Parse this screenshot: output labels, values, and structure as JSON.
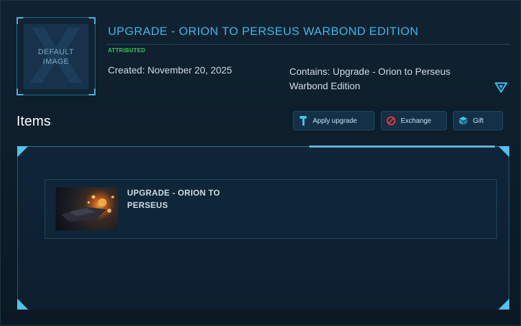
{
  "pledge": {
    "thumbnail_text_line1": "DEFAULT",
    "thumbnail_text_line2": "IMAGE",
    "title": "UPGRADE - ORION TO PERSEUS WARBOND EDITION",
    "badge": "ATTRIBUTED",
    "created": "Created: November 20, 2025",
    "contains": "Contains: Upgrade - Orion to Perseus Warbond Edition",
    "toggle_icon": "chevron-down-triangle-icon"
  },
  "items_section": {
    "heading": "Items",
    "buttons": [
      {
        "label": "Apply upgrade",
        "icon": "hammer-icon"
      },
      {
        "label": "Exchange",
        "icon": "no-entry-icon"
      },
      {
        "label": "Gift",
        "icon": "gift-box-icon"
      }
    ],
    "items": [
      {
        "name": "UPGRADE - ORION TO PERSEUS",
        "image": "ship-thumbnail"
      }
    ]
  },
  "colors": {
    "accent": "#39b9e8",
    "badge_green": "#35d24a",
    "exchange_red": "#e8323a",
    "background": "#0f1f2c"
  }
}
